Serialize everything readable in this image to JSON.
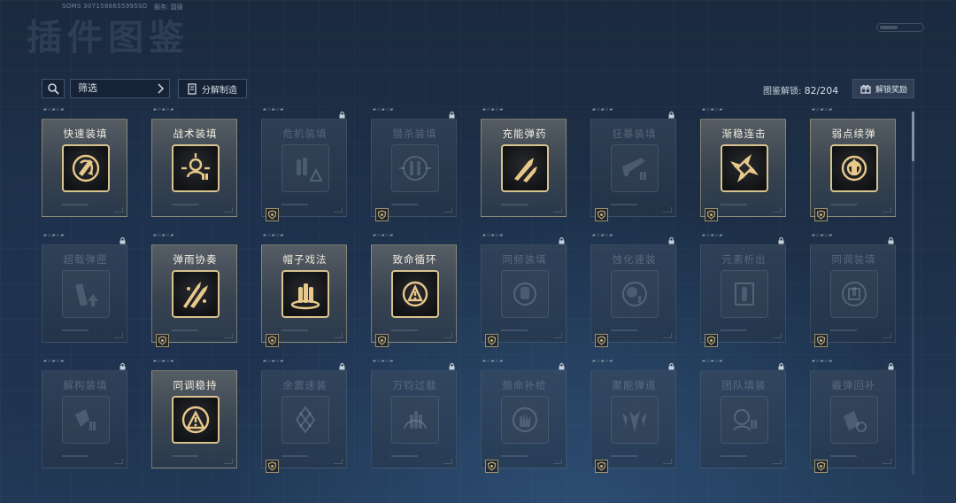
{
  "header": {
    "session_id": "SOMS 3071586655995SO",
    "session_extra": "服务: 国服",
    "title": "插件图鉴"
  },
  "toolbar": {
    "filter_label": "筛选",
    "decompose_label": "分解制造",
    "unlock_label": "图鉴解锁:",
    "unlock_count": "82/204",
    "reward_label": "解锁奖励"
  },
  "colors": {
    "gold_accent": "#d8c28f",
    "background": "#1d3048",
    "locked_text": "#5c6a7c"
  },
  "cards": [
    {
      "name": "快速装填",
      "unlocked": true,
      "locked": false,
      "badge": false,
      "icon": "crossed-ammo-arrow-icon"
    },
    {
      "name": "战术装填",
      "unlocked": true,
      "locked": false,
      "badge": false,
      "icon": "operator-target-icon"
    },
    {
      "name": "危机装填",
      "unlocked": false,
      "locked": true,
      "badge": true,
      "icon": "ammo-warning-icon"
    },
    {
      "name": "猎杀装填",
      "unlocked": false,
      "locked": true,
      "badge": true,
      "icon": "ammo-crosshair-icon"
    },
    {
      "name": "充能弹药",
      "unlocked": true,
      "locked": false,
      "badge": false,
      "icon": "rocket-bullets-icon"
    },
    {
      "name": "狂暴装填",
      "unlocked": false,
      "locked": true,
      "badge": true,
      "icon": "rifle-ammo-icon"
    },
    {
      "name": "渐稳连击",
      "unlocked": true,
      "locked": false,
      "badge": true,
      "icon": "converging-arrows-icon"
    },
    {
      "name": "弱点续弹",
      "unlocked": true,
      "locked": false,
      "badge": true,
      "icon": "weakpoint-reload-icon"
    },
    {
      "name": "超载弹匣",
      "unlocked": false,
      "locked": true,
      "badge": false,
      "icon": "magazine-up-icon"
    },
    {
      "name": "弹雨协奏",
      "unlocked": true,
      "locked": false,
      "badge": true,
      "icon": "bullet-rain-icon"
    },
    {
      "name": "帽子戏法",
      "unlocked": true,
      "locked": false,
      "badge": true,
      "icon": "triple-bullet-icon"
    },
    {
      "name": "致命循环",
      "unlocked": true,
      "locked": false,
      "badge": true,
      "icon": "fatal-cycle-icon"
    },
    {
      "name": "同频装填",
      "unlocked": false,
      "locked": true,
      "badge": true,
      "icon": "sync-reload-icon"
    },
    {
      "name": "蚀化速装",
      "unlocked": false,
      "locked": true,
      "badge": true,
      "icon": "corrode-reload-icon"
    },
    {
      "name": "元素析出",
      "unlocked": false,
      "locked": true,
      "badge": true,
      "icon": "element-extract-icon"
    },
    {
      "name": "同调装填",
      "unlocked": false,
      "locked": true,
      "badge": true,
      "icon": "attune-reload-icon"
    },
    {
      "name": "解构装填",
      "unlocked": false,
      "locked": true,
      "badge": false,
      "icon": "deconstruct-icon"
    },
    {
      "name": "同调稳持",
      "unlocked": true,
      "locked": false,
      "badge": false,
      "icon": "attune-steady-icon"
    },
    {
      "name": "余震速装",
      "unlocked": false,
      "locked": true,
      "badge": true,
      "icon": "aftershock-icon"
    },
    {
      "name": "万钧过载",
      "unlocked": false,
      "locked": true,
      "badge": false,
      "icon": "heavy-overload-icon"
    },
    {
      "name": "殒命补给",
      "unlocked": false,
      "locked": true,
      "badge": true,
      "icon": "death-supply-icon"
    },
    {
      "name": "聚能弹道",
      "unlocked": false,
      "locked": true,
      "badge": true,
      "icon": "focus-trajectory-icon"
    },
    {
      "name": "团队填装",
      "unlocked": false,
      "locked": true,
      "badge": false,
      "icon": "team-reload-icon"
    },
    {
      "name": "霰弹回补",
      "unlocked": false,
      "locked": true,
      "badge": true,
      "icon": "shotgun-refill-icon"
    }
  ]
}
